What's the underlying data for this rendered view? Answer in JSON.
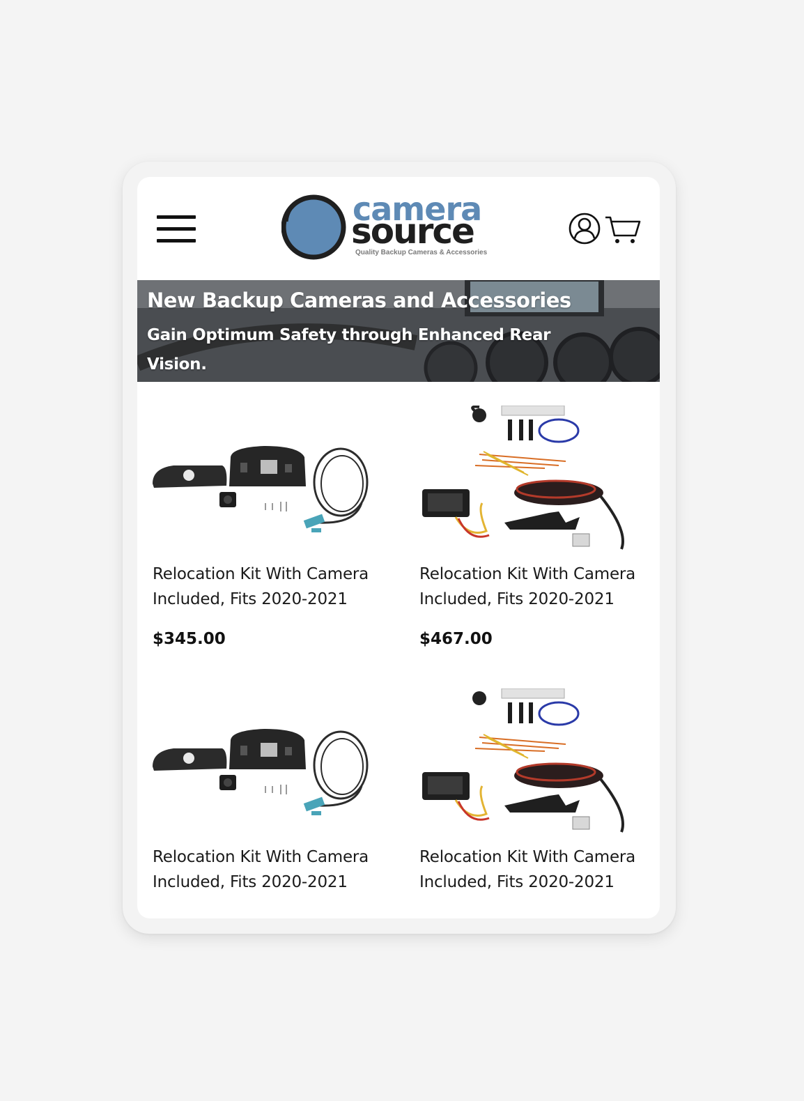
{
  "header": {
    "menu_icon": "hamburger-icon",
    "logo": {
      "word1": "camera",
      "word2": "source",
      "tagline": "Quality Backup Cameras & Accessories"
    },
    "account_icon": "user-icon",
    "cart_icon": "cart-icon"
  },
  "banner": {
    "title": "New Backup Cameras and Accessories",
    "subtitle": "Gain Optimum Safety through Enhanced Rear Vision."
  },
  "products": [
    {
      "name": "Relocation Kit With Camera Included, Fits 2020-2021",
      "price": "$345.00",
      "image": "relocation-kit-housing-image"
    },
    {
      "name": "Relocation Kit With Camera Included, Fits 2020-2021",
      "price": "$467.00",
      "image": "camera-wiring-kit-image"
    },
    {
      "name": "Relocation Kit With Camera Included, Fits 2020-2021",
      "price": "",
      "image": "relocation-kit-housing-image"
    },
    {
      "name": "Relocation Kit With Camera Included, Fits 2020-2021",
      "price": "",
      "image": "camera-wiring-kit-image"
    }
  ],
  "colors": {
    "brand_blue": "#5e8ab5",
    "text_dark": "#111111",
    "page_bg": "#f4f4f4"
  }
}
